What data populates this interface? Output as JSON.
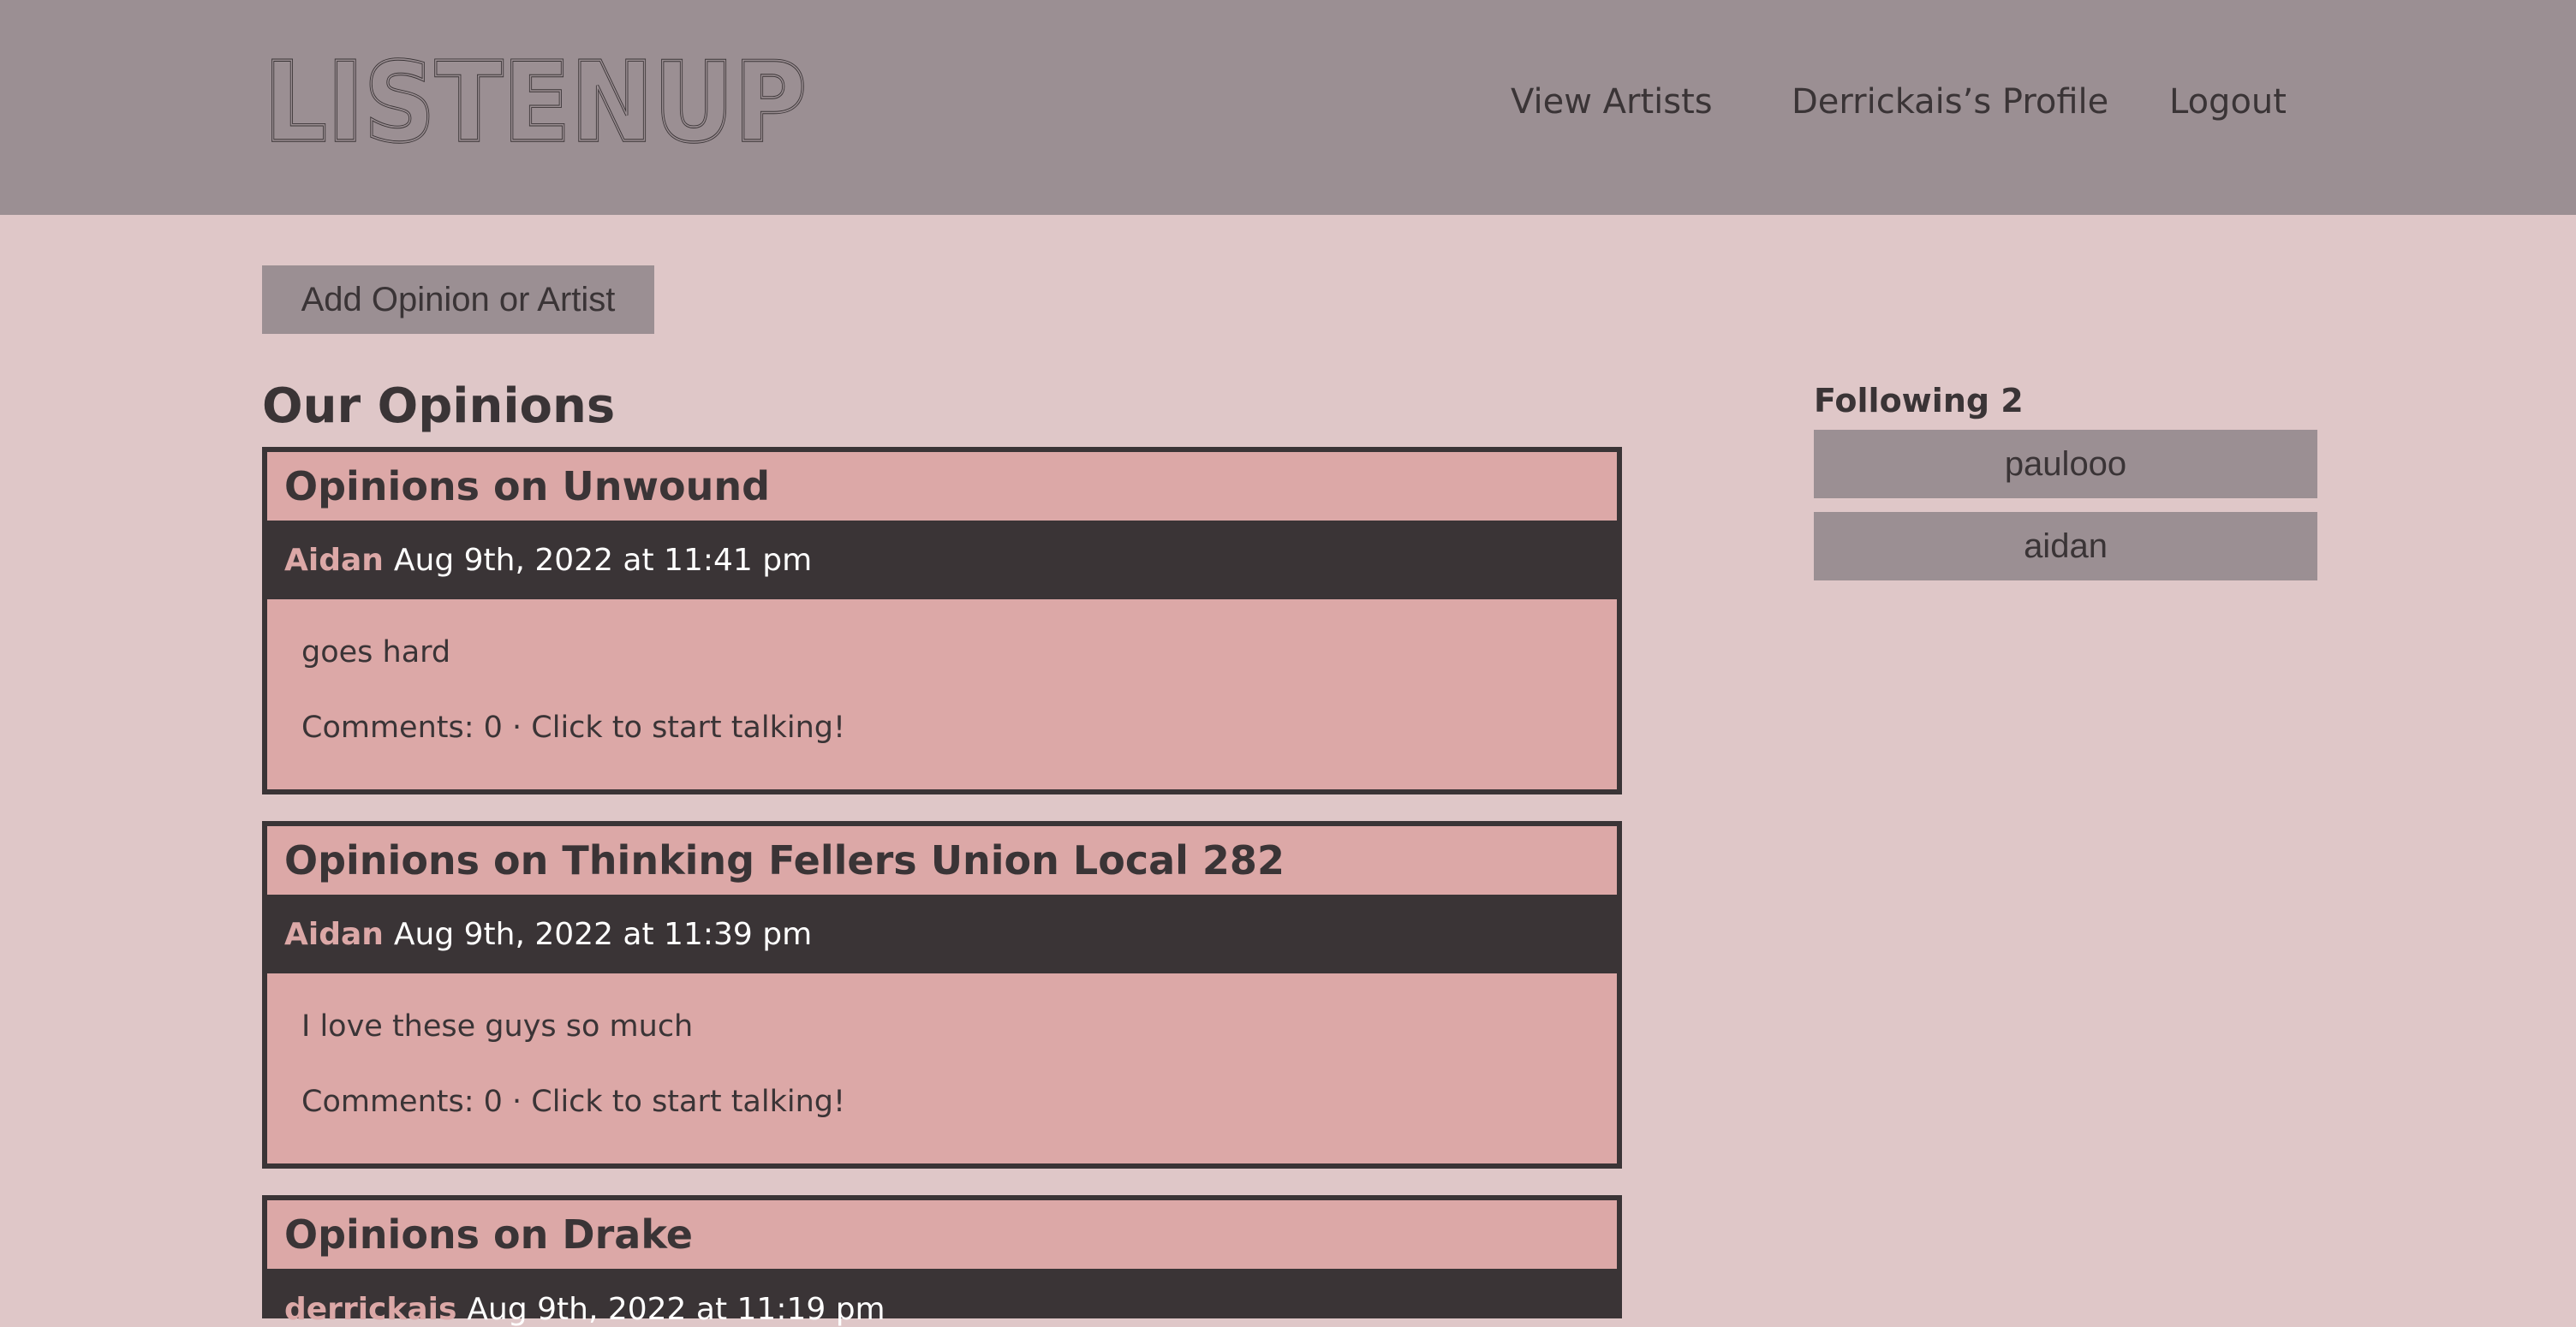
{
  "header": {
    "logo_text": "LISTENUP",
    "nav": {
      "artists": "View Artists",
      "profile": "Derrickais’s Profile",
      "logout": "Logout"
    }
  },
  "actions": {
    "add_label": "Add Opinion or Artist"
  },
  "main": {
    "section_title": "Our Opinions",
    "opinions": [
      {
        "title": "Opinions on Unwound",
        "author": "Aidan",
        "date": "Aug 9th, 2022 at 11:41 pm",
        "text": "goes hard",
        "comments": "Comments: 0 · Click to start talking!"
      },
      {
        "title": "Opinions on Thinking Fellers Union Local 282",
        "author": "Aidan",
        "date": "Aug 9th, 2022 at 11:39 pm",
        "text": "I love these guys so much",
        "comments": "Comments: 0 · Click to start talking!"
      },
      {
        "title": "Opinions on Drake",
        "author": "derrickais",
        "date": "Aug 9th, 2022 at 11:19 pm",
        "text": "",
        "comments": ""
      }
    ]
  },
  "sidebar": {
    "following_title": "Following 2",
    "following": [
      "paulooo",
      "aidan"
    ]
  },
  "colors": {
    "page_bg": "#dfc7c8",
    "header_bg": "#9b8f93",
    "card_bg": "#dca8a7",
    "dark": "#3a3436"
  }
}
